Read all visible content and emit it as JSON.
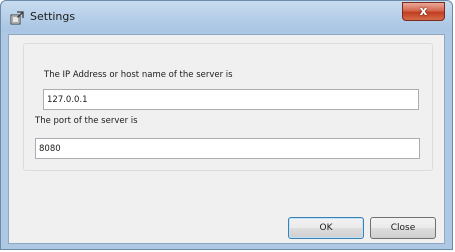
{
  "window": {
    "title": "Settings",
    "close_glyph": "x",
    "icon": "settings-window-icon"
  },
  "form": {
    "host_label": "The IP Address or host name of the server is",
    "host_value": "127.0.0.1",
    "port_label": "The port of the server is",
    "port_value": "8080"
  },
  "buttons": {
    "ok_label": "OK",
    "close_label": "Close"
  },
  "colors": {
    "titlebar": "#b9d1ea",
    "close_button": "#c13e22",
    "client_background": "#f0f0f0",
    "default_button_border": "#3c7fb1"
  }
}
